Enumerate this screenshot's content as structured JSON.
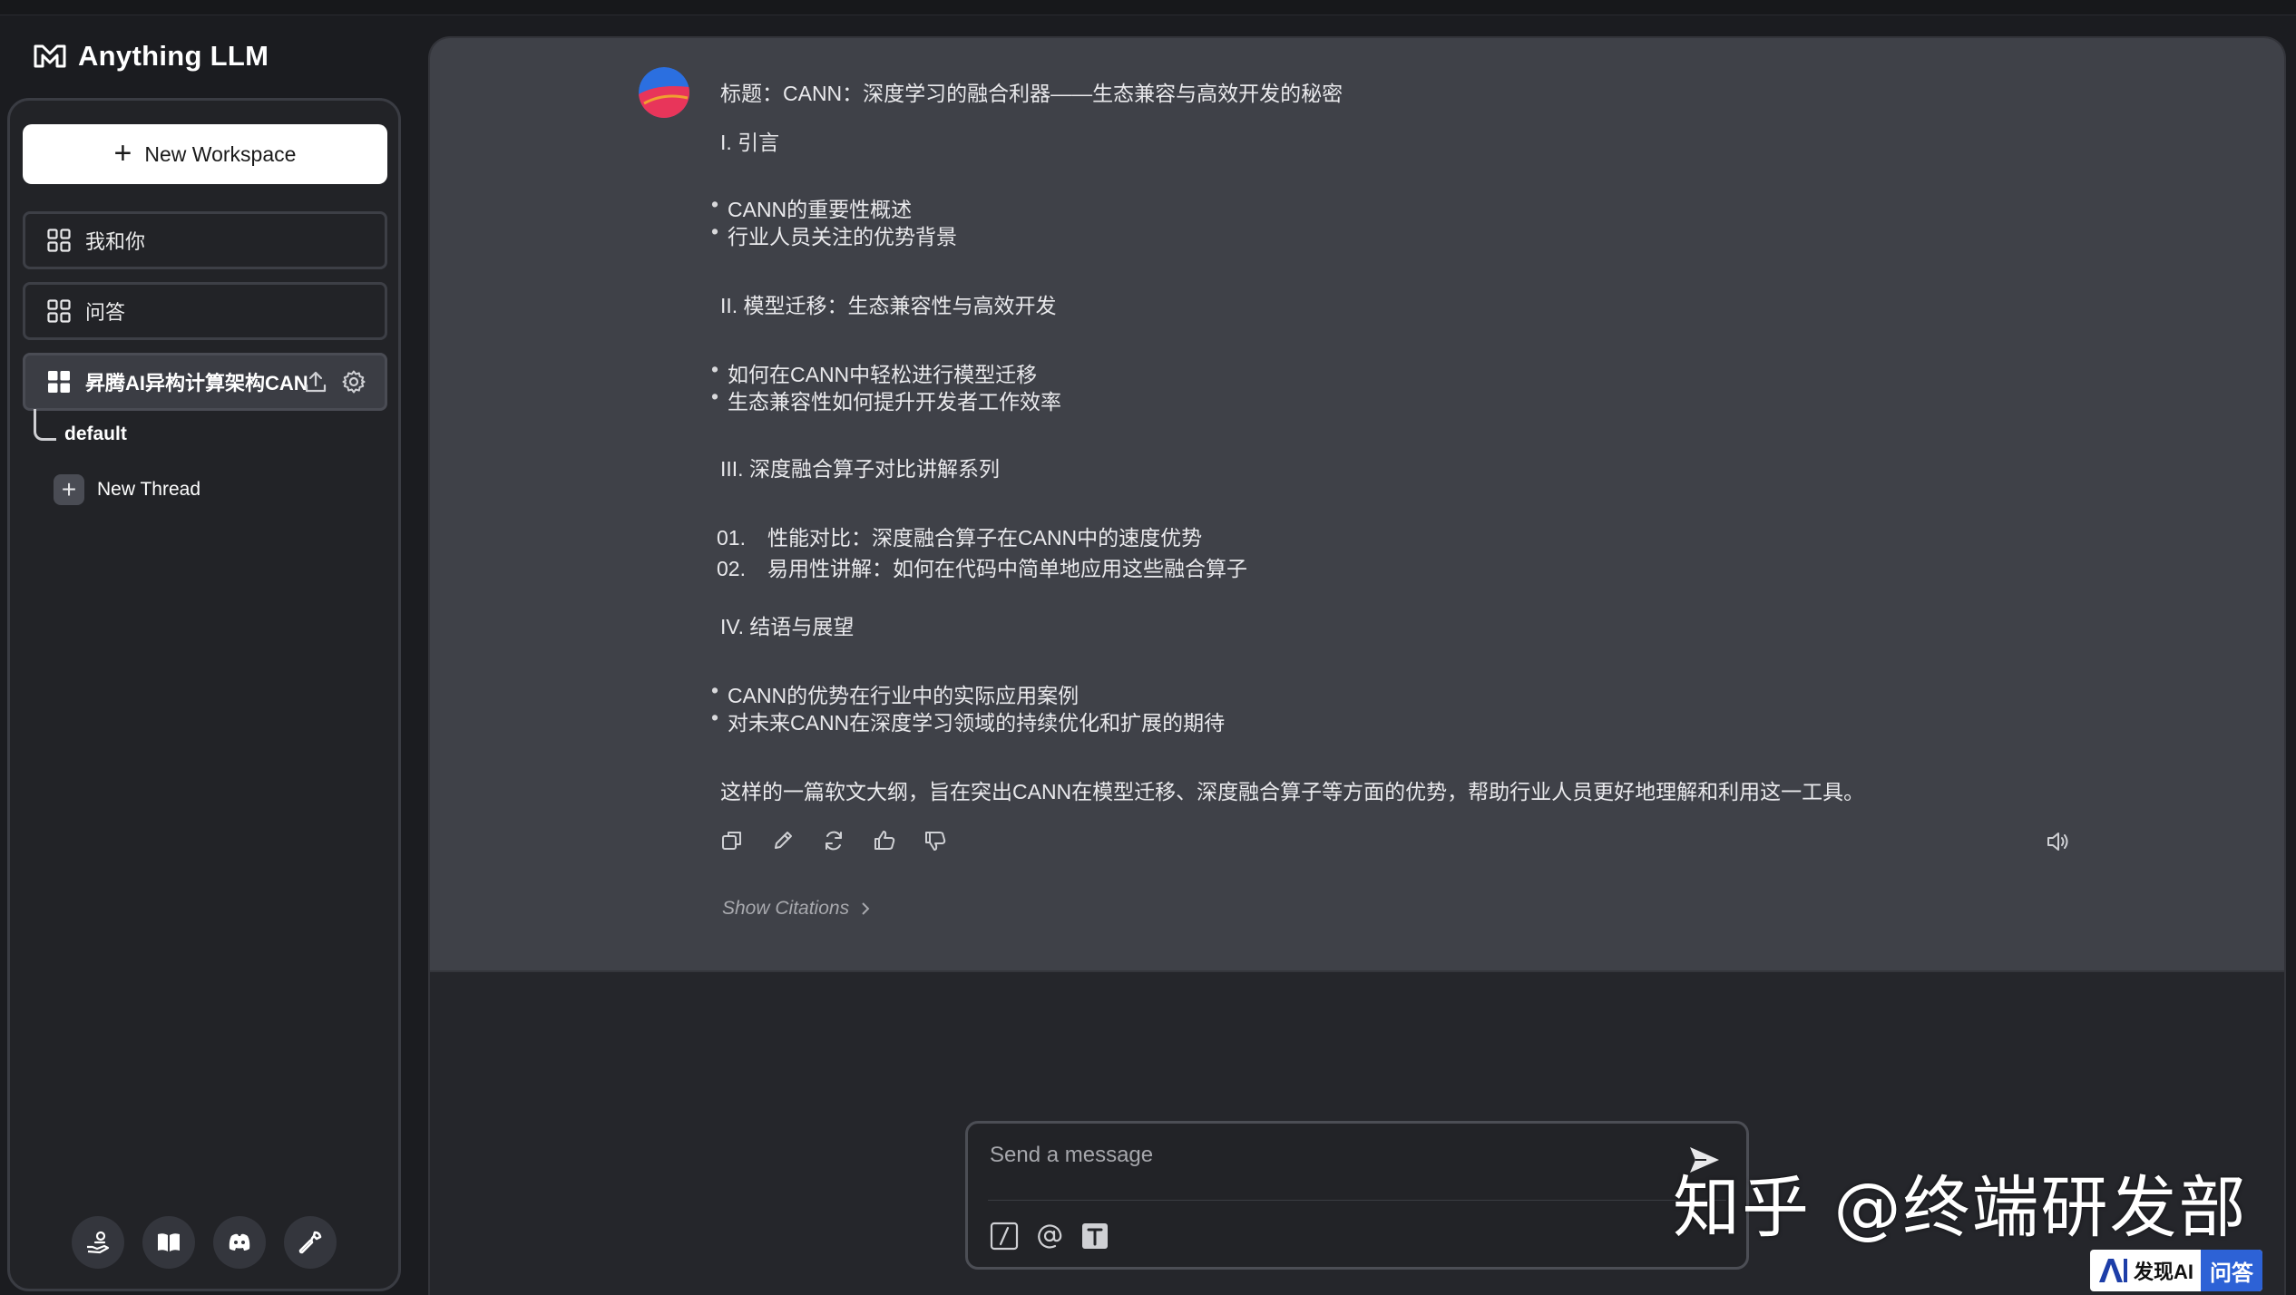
{
  "app": {
    "name": "Anything LLM"
  },
  "sidebar": {
    "new_workspace": "New Workspace",
    "workspaces": [
      {
        "label": "我和你"
      },
      {
        "label": "问答"
      },
      {
        "label": "昇腾AI异构计算架构CAN"
      }
    ],
    "thread_default": "default",
    "new_thread": "New Thread",
    "footer_icons": [
      "community-hub-icon",
      "docs-book-icon",
      "discord-icon",
      "settings-wrench-icon"
    ]
  },
  "message": {
    "title": "标题：CANN：深度学习的融合利器——生态兼容与高效开发的秘密",
    "s1": "I. 引言",
    "s1_b1": "CANN的重要性概述",
    "s1_b2": "行业人员关注的优势背景",
    "s2": "II. 模型迁移：生态兼容性与高效开发",
    "s2_b1": "如何在CANN中轻松进行模型迁移",
    "s2_b2": "生态兼容性如何提升开发者工作效率",
    "s3": "III. 深度融合算子对比讲解系列",
    "s3_n1_num": "01.",
    "s3_n1": "性能对比：深度融合算子在CANN中的速度优势",
    "s3_n2_num": "02.",
    "s3_n2": "易用性讲解：如何在代码中简单地应用这些融合算子",
    "s4": "IV. 结语与展望",
    "s4_b1": "CANN的优势在行业中的实际应用案例",
    "s4_b2": "对未来CANN在深度学习领域的持续优化和扩展的期待",
    "summary": "这样的一篇软文大纲，旨在突出CANN在模型迁移、深度融合算子等方面的优势，帮助行业人员更好地理解和利用这一工具。",
    "show_citations": "Show Citations"
  },
  "composer": {
    "placeholder": "Send a message"
  },
  "watermark": {
    "text": "知乎 @终端研发部"
  },
  "badge": {
    "brand": "发现AI",
    "qa": "问答"
  }
}
